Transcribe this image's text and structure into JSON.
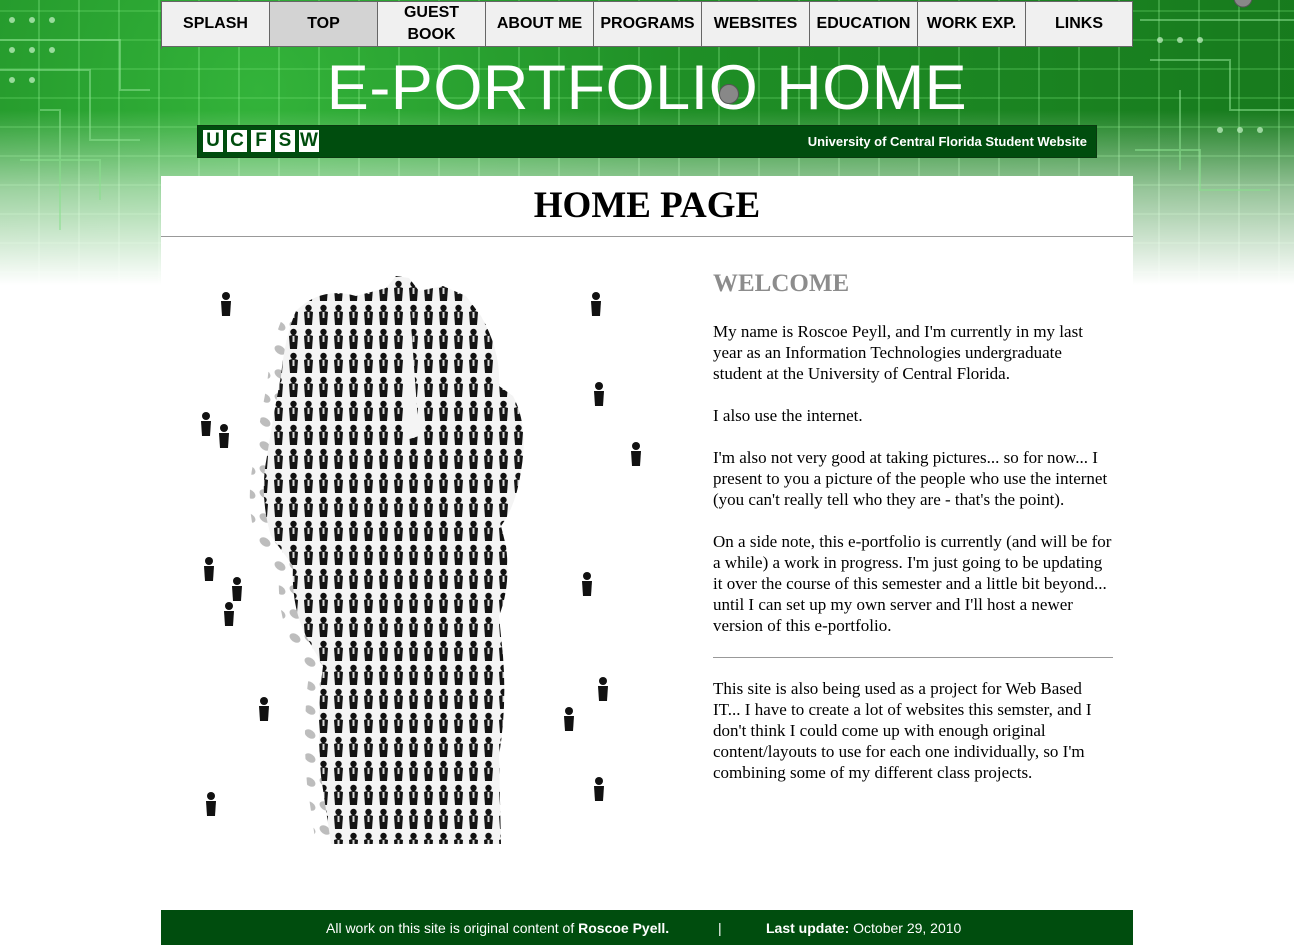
{
  "nav": {
    "items": [
      {
        "label": "SPLASH"
      },
      {
        "label": "TOP"
      },
      {
        "label": "GUEST BOOK"
      },
      {
        "label": "ABOUT ME"
      },
      {
        "label": "PROGRAMS"
      },
      {
        "label": "WEBSITES"
      },
      {
        "label": "EDUCATION"
      },
      {
        "label": "WORK EXP."
      },
      {
        "label": "LINKS"
      }
    ]
  },
  "header": {
    "title": "E-PORTFOLIO HOME",
    "logo_letters": [
      "U",
      "C",
      "F",
      "S",
      "W"
    ],
    "banner_text": "University of Central Florida Student Website"
  },
  "main": {
    "page_title": "HOME PAGE",
    "welcome": "WELCOME",
    "paragraphs": [
      "My name is Roscoe Peyll, and I'm currently in my last year as an Information Technologies undergraduate student at the University of Central Florida.",
      "I also use the internet.",
      "I'm also not very good at taking pictures... so for now... I present to you a picture of the people who use the internet (you can't really tell who they are - that's the point).",
      "On a side note, this e-portfolio is currently (and will be for a while) a work in progress. I'm just going to be updating it over the course of this semester and a little bit beyond... until I can set up my own server and I'll host a newer version of this e-portfolio.",
      "This site is also being used as a project for Web Based IT... I have to create a lot of websites this semster, and I don't think I could come up with enough original content/layouts to use for each one individually, so I'm combining some of my different class projects."
    ]
  },
  "footer": {
    "prefix": "All work on this site is original content of",
    "author": "Roscoe Pyell.",
    "separator": "|",
    "update_label": "Last update:",
    "update_date": "October 29, 2010"
  },
  "colors": {
    "brand_green": "#004d0e",
    "circuit_green": "#1f8f26",
    "welcome_gray": "#8c8c8c"
  }
}
